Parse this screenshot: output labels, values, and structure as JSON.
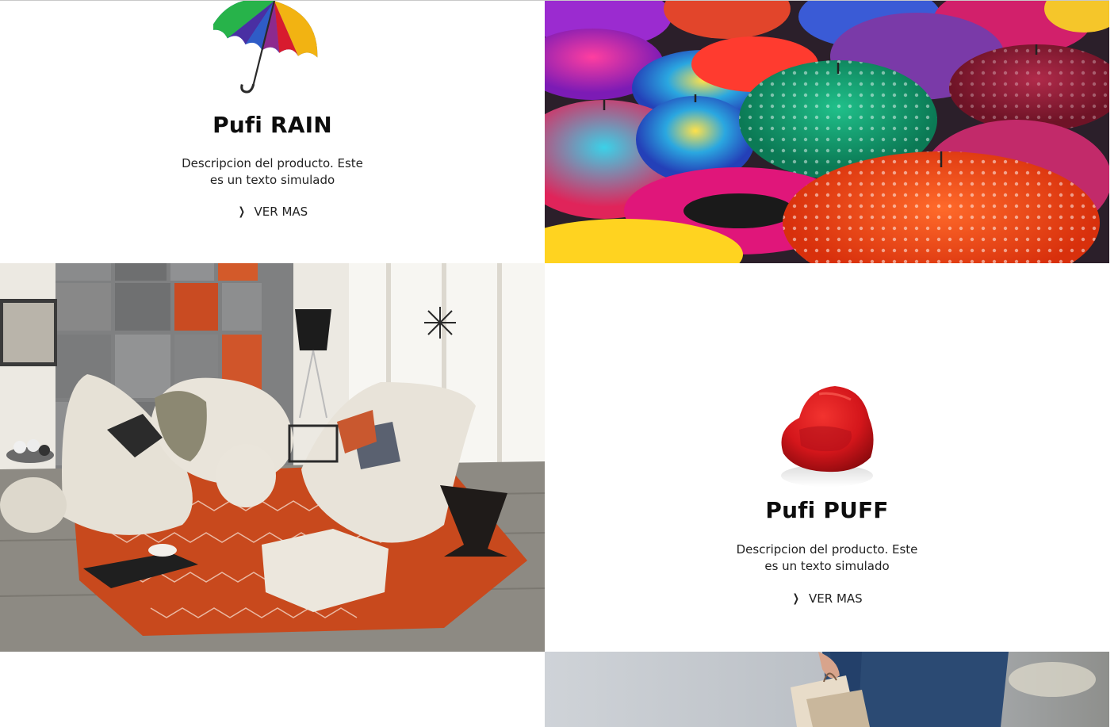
{
  "products": [
    {
      "title": "Pufi RAIN",
      "description": "Descripcion del producto. Este es un texto simulado",
      "link_label": "VER MAS",
      "link_icon": "chevron-right-icon",
      "product_icon": "umbrella-icon"
    },
    {
      "title": "Pufi PUFF",
      "description": "Descripcion del producto. Este es un texto simulado",
      "link_label": "VER MAS",
      "link_icon": "chevron-right-icon",
      "product_icon": "bean-bag-icon"
    }
  ],
  "colors": {
    "umbrella_red": "#d81b2e",
    "bean_bag_red": "#d4161b",
    "rug_orange": "#c8491d"
  }
}
